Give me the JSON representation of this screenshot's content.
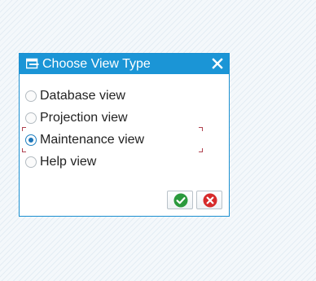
{
  "dialog": {
    "title": "Choose View Type",
    "title_icon": "dialog-window-icon",
    "close_icon": "close-icon",
    "options": [
      {
        "label": "Database view",
        "selected": false
      },
      {
        "label": "Projection view",
        "selected": false
      },
      {
        "label": "Maintenance view",
        "selected": true
      },
      {
        "label": "Help view",
        "selected": false
      }
    ],
    "buttons": {
      "confirm_icon": "checkmark-icon",
      "cancel_icon": "cancel-x-icon"
    }
  },
  "colors": {
    "titlebar": "#1b95d6",
    "dialog_border": "#1a8fd0",
    "confirm": "#2b9a3d",
    "cancel": "#d62b2b",
    "focus_corners": "#b0424f",
    "radio_selected": "#1d75b8"
  }
}
